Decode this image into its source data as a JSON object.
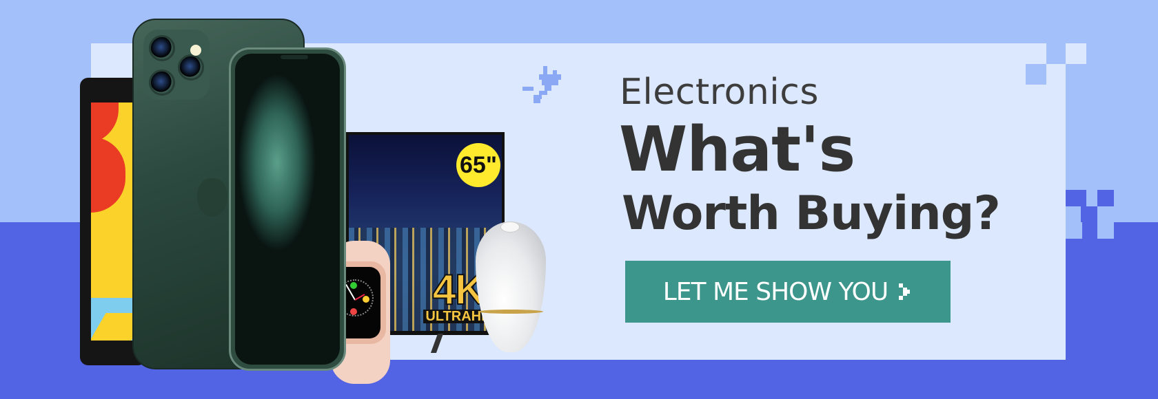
{
  "banner": {
    "category": "Electronics",
    "headline_line1": "What's",
    "headline_line2": "Worth Buying?",
    "cta_label": "LET ME SHOW YOU"
  },
  "products": {
    "tv_size_badge": "65\"",
    "tv_resolution_main": "4K",
    "tv_resolution_sub": "ULTRAHD"
  },
  "colors": {
    "background_light": "#a3c0fb",
    "background_dark": "#5263e3",
    "panel": "#dce8fe",
    "cta": "#3c968b",
    "text": "#333333",
    "pixel_accent": "#a3c0fb"
  },
  "icons": {
    "plug": "plug-icon",
    "cta_arrow": "chevron-right-icon"
  }
}
